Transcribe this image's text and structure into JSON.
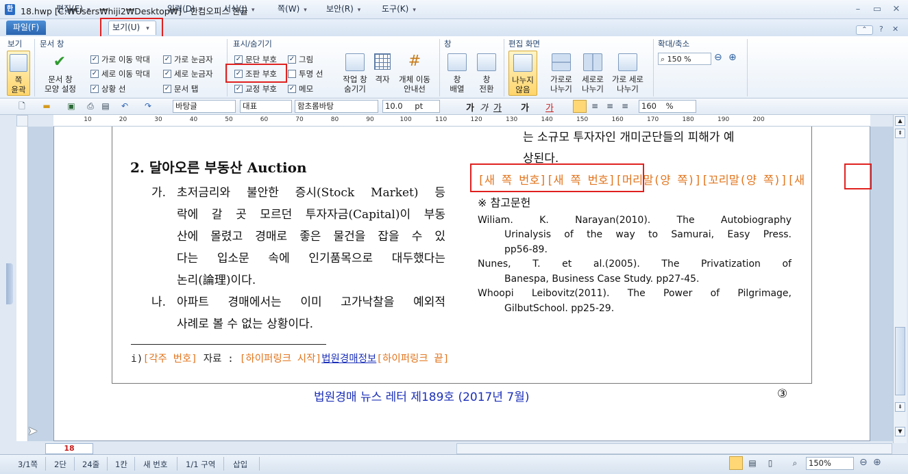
{
  "window": {
    "title": "18.hwp [C:₩Users₩hiji2₩Desktop₩] - 한컴오피스 한글",
    "app_icon_label": "한",
    "controls": {
      "minimize": "–",
      "restore": "▭",
      "close": "✕"
    },
    "secondary_controls": {
      "collapse": "⌃",
      "help": "?",
      "close": "✕"
    }
  },
  "menu": {
    "file": "파일(F)",
    "items": [
      "편집(E)",
      "보기(U)",
      "입력(D)",
      "서식(J)",
      "쪽(W)",
      "보안(R)",
      "도구(K)"
    ]
  },
  "ribbon": {
    "groups": {
      "view": "보기",
      "doc_window": "문서 창",
      "show_hide": "표시/숨기기",
      "window": "창",
      "edit_screen": "편집 화면",
      "zoom": "확대/축소"
    },
    "buttons": {
      "fit_page": [
        "쪽",
        "윤곽"
      ],
      "doc_window_shape": [
        "문서 창",
        "모양 설정"
      ],
      "hide_work_window": [
        "작업 창",
        "숨기기"
      ],
      "grid": [
        "격자"
      ],
      "object_move_guide": [
        "개체 이동",
        "안내선"
      ],
      "window_arrange": [
        "창",
        "배열"
      ],
      "window_switch": [
        "창",
        "전환"
      ],
      "no_split": [
        "나누지",
        "않음"
      ],
      "split_horizontal": [
        "가로로",
        "나누기"
      ],
      "split_vertical": [
        "세로로",
        "나누기"
      ],
      "split_both": [
        "가로 세로",
        "나누기"
      ]
    },
    "doc_window_checks": [
      {
        "label": "가로 이동 막대",
        "checked": true
      },
      {
        "label": "가로 눈금자",
        "checked": true
      },
      {
        "label": "세로 이동 막대",
        "checked": true
      },
      {
        "label": "세로 눈금자",
        "checked": true
      },
      {
        "label": "상황 선",
        "checked": true
      },
      {
        "label": "문서 탭",
        "checked": true
      }
    ],
    "show_hide_checks": [
      {
        "label": "문단 부호",
        "checked": true
      },
      {
        "label": "그림",
        "checked": true
      },
      {
        "label": "조판 부호",
        "checked": true
      },
      {
        "label": "투명 선",
        "checked": false
      },
      {
        "label": "교정 부호",
        "checked": true
      },
      {
        "label": "메모",
        "checked": true
      }
    ],
    "zoom_value": "150 %"
  },
  "toolbar": {
    "style": "바탕글",
    "language": "대표",
    "font": "함초롬바탕",
    "size": "10.0",
    "size_unit": "pt",
    "line_spacing": "160",
    "line_spacing_unit": "%",
    "format_buttons": [
      "가",
      "가",
      "가",
      "가",
      "가"
    ]
  },
  "ruler": {
    "labels": [
      "10",
      "20",
      "30",
      "40",
      "50",
      "60",
      "70",
      "80",
      "90",
      "100",
      "110",
      "120",
      "130",
      "140",
      "150",
      "160",
      "170",
      "180",
      "190",
      "200"
    ]
  },
  "document": {
    "left_column": {
      "heading": "2. 달아오른 부동산 Auction",
      "items": [
        {
          "marker": "가.",
          "lines": [
            "초저금리와 불안한 증시(Stock Market) 등",
            "락에 갈 곳 모르던 투자자금(Capital)이 부동",
            "산에 몰렸고 경매로 좋은 물건을 잡을 수 있",
            "다는 입소문 속에 인기품목으로 대두했다는",
            "논리(論理)이다."
          ]
        },
        {
          "marker": "나.",
          "lines": [
            "아파트 경매에서는 이미 고가낙찰을 예외적",
            "사례로 볼 수 없는 상황이다."
          ]
        }
      ],
      "footnote": {
        "prefix": "i)",
        "code1": "[각주 번호]",
        "text": "자료 :",
        "code2": "[하이퍼링크 시작]",
        "link": "법원경매정보",
        "code3": "[하이퍼링크 끝]"
      }
    },
    "right_column": {
      "top_lines": [
        "는 소규모 투자자인 개미군단들의 피해가 예",
        "상된다."
      ],
      "codes_line": "[새 쪽 번호][새 쪽 번호][머리말(양 쪽)][꼬리말(양 쪽)][새",
      "ref_title": "※ 참고문헌",
      "references": [
        [
          "Wiliam. K. Narayan(2010). The Autobiography",
          "Urinalysis of the way to Samurai, Easy Press.",
          "pp56-89."
        ],
        [
          "Nunes, T. et al.(2005). The Privatization of",
          "Banespa, Business Case Study. pp27-45."
        ],
        [
          "Whoopi Leibovitz(2011). The Power of Pilgrimage,",
          "GilbutSchool. pp25-29."
        ]
      ]
    },
    "footer_title": "법원경매 뉴스 레터 제189호 (2017년 7월)",
    "page_marker": "③"
  },
  "doc_tab": "18",
  "status": {
    "page": "3/1쪽",
    "column": "2단",
    "line": "24줄",
    "col": "1칸",
    "page_num": "새 번호",
    "section": "1/1 구역",
    "mode": "삽입",
    "zoom": "150%"
  }
}
